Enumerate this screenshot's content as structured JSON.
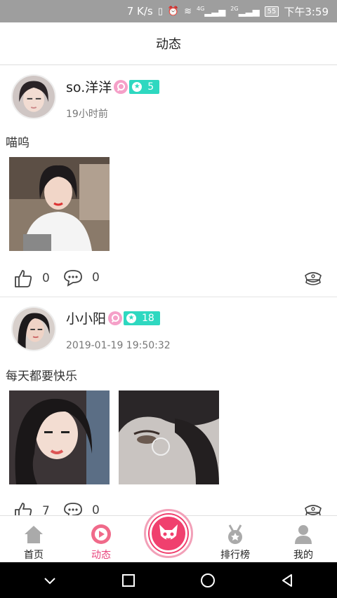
{
  "status_bar": {
    "speed": "7 K/s",
    "network_4g": "4G",
    "network_2g": "2G",
    "battery": "55",
    "time": "下午3:59"
  },
  "header": {
    "title": "动态"
  },
  "posts": [
    {
      "username": "so.洋洋",
      "gender": "female",
      "level": "5",
      "time": "19小时前",
      "text": "喵呜",
      "likes": "0",
      "comments": "0"
    },
    {
      "username": "小小阳",
      "gender": "female",
      "level": "18",
      "time": "2019-01-19 19:50:32",
      "text": "每天都要快乐",
      "likes": "7",
      "comments": "0"
    }
  ],
  "tabbar": {
    "home": "首页",
    "feed": "动态",
    "rank": "排行榜",
    "mine": "我的",
    "active": "feed"
  },
  "colors": {
    "accent": "#e8457d",
    "level_badge": "#2ed8c0",
    "gender_female": "#f5a0c8",
    "statusbar": "#9e9e9e"
  }
}
